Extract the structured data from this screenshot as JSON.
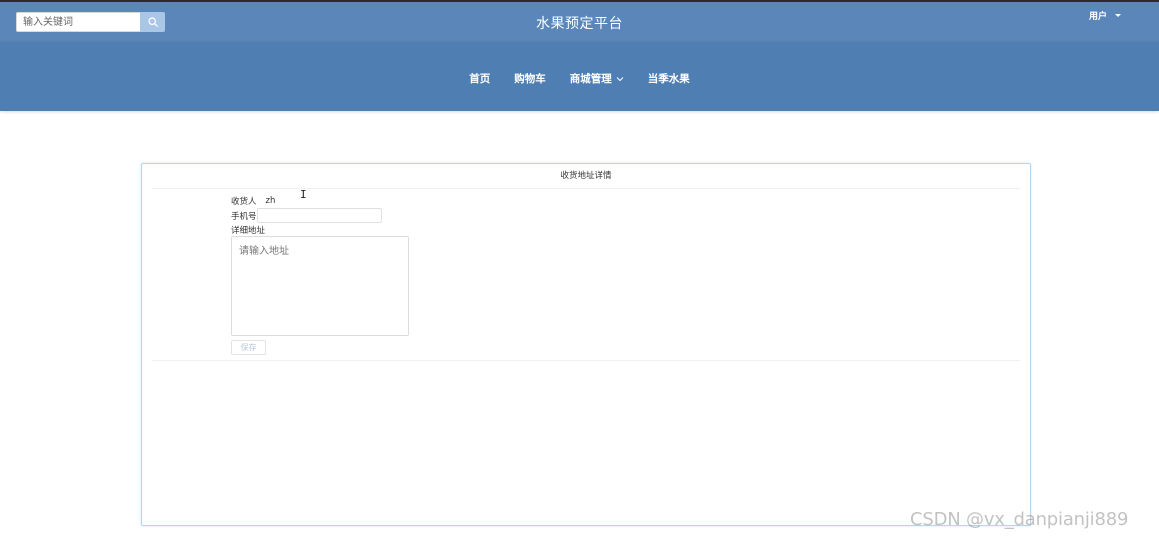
{
  "header": {
    "search": {
      "placeholder": "输入关键词",
      "icon": "search-icon"
    },
    "title": "水果预定平台",
    "user_menu": {
      "label": "用户",
      "icon": "caret-down-icon"
    }
  },
  "nav": {
    "items": [
      {
        "label": "首页"
      },
      {
        "label": "购物车"
      },
      {
        "label": "商城管理",
        "icon": "chevron-down-icon"
      },
      {
        "label": "当季水果"
      }
    ]
  },
  "card": {
    "title": "收货地址详情",
    "receiver_label": "收货人",
    "receiver_value": "zh",
    "phone_label": "手机号",
    "phone_value": "",
    "address_label": "详细地址",
    "address_placeholder": "请输入地址",
    "save_label": "保存"
  },
  "watermark": "CSDN @vx_danpianji889",
  "colors": {
    "topbar": "#5a86b9",
    "navbar": "#4f7eb3",
    "search_button": "#a9c6e6",
    "card_border": "#b7d7ee"
  }
}
